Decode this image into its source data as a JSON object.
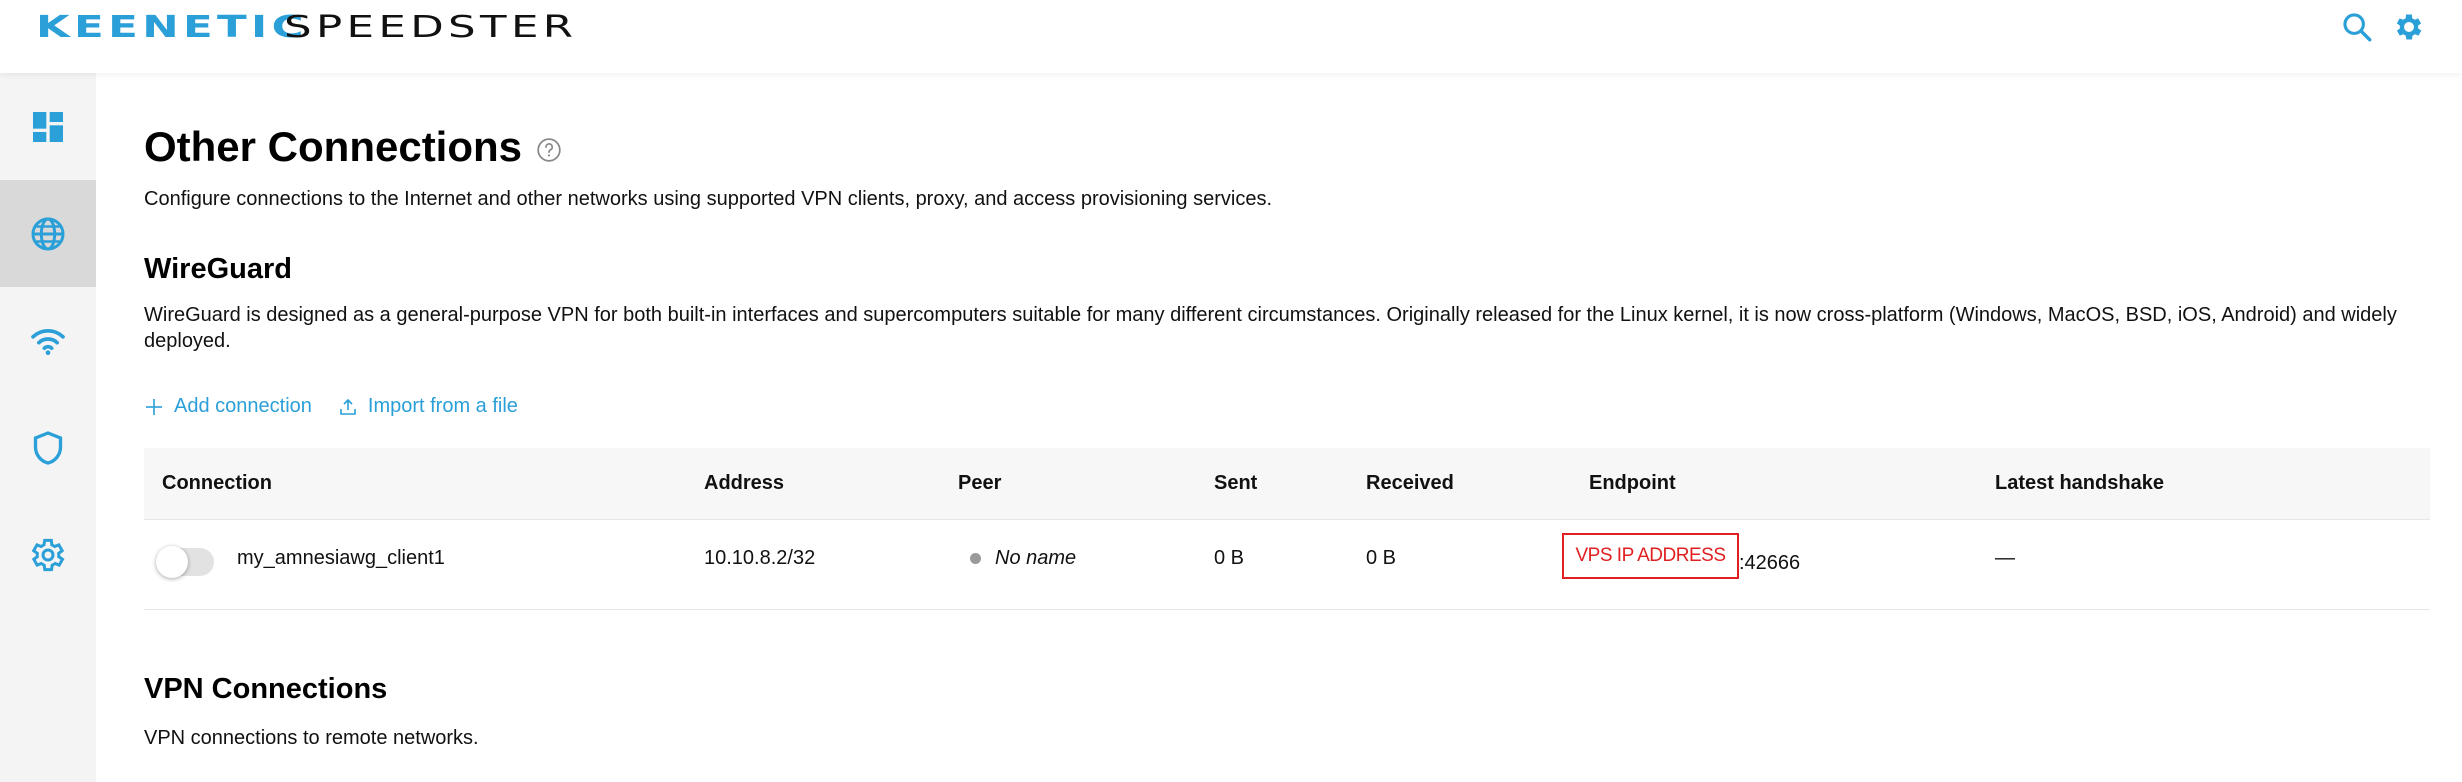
{
  "header": {
    "brand_primary": "KEENETIC",
    "brand_secondary": "SPEEDSTER",
    "brand_color": "#2a9fd8",
    "icons": [
      "search-icon",
      "gear-icon"
    ]
  },
  "sidebar": {
    "items": [
      {
        "icon": "dashboard-icon",
        "active": false
      },
      {
        "icon": "globe-icon",
        "active": true
      },
      {
        "icon": "wifi-icon",
        "active": false
      },
      {
        "icon": "shield-icon",
        "active": false
      },
      {
        "icon": "gear-icon",
        "active": false
      }
    ]
  },
  "page": {
    "title": "Other Connections",
    "description": "Configure connections to the Internet and other networks using supported VPN clients, proxy, and access provisioning services."
  },
  "wireguard": {
    "title": "WireGuard",
    "description": "WireGuard is designed as a general-purpose VPN for both built-in interfaces and supercomputers suitable for many different circumstances. Originally released for the Linux kernel, it is now cross-platform (Windows, MacOS, BSD, iOS, Android) and widely deployed.",
    "add_label": "Add connection",
    "import_label": "Import from a file",
    "table": {
      "headers": {
        "connection": "Connection",
        "address": "Address",
        "peer": "Peer",
        "sent": "Sent",
        "received": "Received",
        "endpoint": "Endpoint",
        "handshake": "Latest handshake"
      },
      "rows": [
        {
          "enabled": false,
          "connection": "my_amnesiawg_client1",
          "address": "10.10.8.2/32",
          "peer": "No name",
          "sent": "0 B",
          "received": "0 B",
          "endpoint_redacted": "VPS IP ADDRESS",
          "endpoint_port": ":42666",
          "handshake": "—"
        }
      ]
    }
  },
  "vpn": {
    "title": "VPN Connections",
    "description": "VPN connections to remote networks."
  }
}
